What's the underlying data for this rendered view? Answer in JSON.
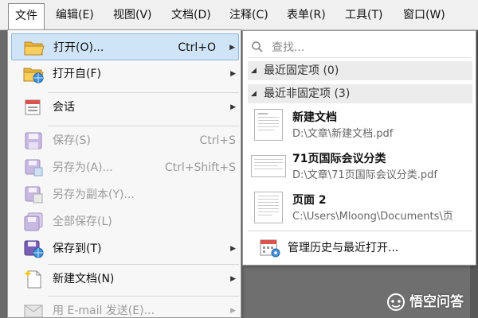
{
  "menubar": {
    "items": [
      {
        "label": "文件"
      },
      {
        "label": "编辑(E)"
      },
      {
        "label": "视图(V)"
      },
      {
        "label": "文档(D)"
      },
      {
        "label": "注释(C)"
      },
      {
        "label": "表单(R)"
      },
      {
        "label": "工具(T)"
      },
      {
        "label": "窗口(W)"
      }
    ]
  },
  "file_menu": {
    "items": [
      {
        "label": "打开(O)...",
        "shortcut": "Ctrl+O",
        "submenu": true,
        "enabled": true,
        "highlighted": true,
        "icon": "folder-open-icon"
      },
      {
        "label": "打开自(F)",
        "shortcut": "",
        "submenu": true,
        "enabled": true,
        "icon": "folder-globe-icon"
      },
      {
        "label": "会话",
        "shortcut": "",
        "submenu": true,
        "enabled": true,
        "icon": "session-icon"
      },
      {
        "label": "保存(S)",
        "shortcut": "Ctrl+S",
        "submenu": false,
        "enabled": false,
        "icon": "save-icon"
      },
      {
        "label": "另存为(A)...",
        "shortcut": "Ctrl+Shift+S",
        "submenu": false,
        "enabled": false,
        "icon": "save-as-icon"
      },
      {
        "label": "另存为副本(Y)...",
        "shortcut": "",
        "submenu": false,
        "enabled": false,
        "icon": "save-copy-icon"
      },
      {
        "label": "全部保存(L)",
        "shortcut": "",
        "submenu": false,
        "enabled": false,
        "icon": "save-all-icon"
      },
      {
        "label": "保存到(T)",
        "shortcut": "",
        "submenu": true,
        "enabled": true,
        "icon": "save-to-icon"
      },
      {
        "label": "新建文档(N)",
        "shortcut": "",
        "submenu": true,
        "enabled": true,
        "icon": "new-document-icon"
      },
      {
        "label": "用 E-mail 发送(E)...",
        "shortcut": "",
        "submenu": true,
        "enabled": false,
        "icon": "email-icon"
      }
    ]
  },
  "open_submenu": {
    "search_placeholder": "查找...",
    "pinned_group": "最近固定项 (0)",
    "unpinned_group": "最近非固定项 (3)",
    "recent_files": [
      {
        "name": "新建文档",
        "path": "D:\\文章\\新建文档.pdf"
      },
      {
        "name": "71页国际会议分类",
        "path": "D:\\文章\\71页国际会议分类.pdf"
      },
      {
        "name": "页面 2",
        "path": "C:\\Users\\Mloong\\Documents\\页"
      }
    ],
    "history_label": "管理历史与最近打开..."
  },
  "watermark": {
    "text": "悟空问答"
  },
  "colors": {
    "highlight": "#cfe4f7",
    "highlight_border": "#8fb8de",
    "disabled_text": "#9a9a9a"
  }
}
